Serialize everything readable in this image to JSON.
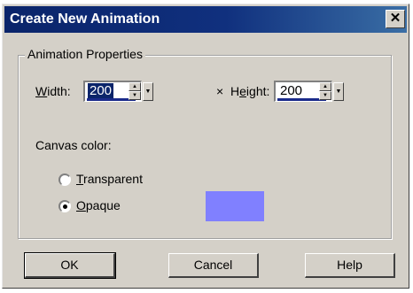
{
  "window": {
    "title": "Create New Animation",
    "close_glyph": "✕"
  },
  "group": {
    "legend": "Animation Properties"
  },
  "width_field": {
    "label_mnemonic": "W",
    "label_rest": "idth:",
    "value": "200"
  },
  "height_field": {
    "separator": "×",
    "label_prefix": "H",
    "label_mnemonic": "e",
    "label_rest": "ight:",
    "value": "200"
  },
  "canvas": {
    "label": "Canvas color:",
    "options": [
      {
        "mnemonic": "T",
        "rest": "ransparent",
        "selected": false
      },
      {
        "mnemonic": "O",
        "rest": "paque",
        "selected": true
      }
    ],
    "swatch_color": "#8080ff"
  },
  "buttons": {
    "ok": "OK",
    "cancel": "Cancel",
    "help": "Help"
  },
  "colors": {
    "face": "#d4d0c8",
    "title_bar": "#0a246a",
    "selection": "#0a246a"
  }
}
